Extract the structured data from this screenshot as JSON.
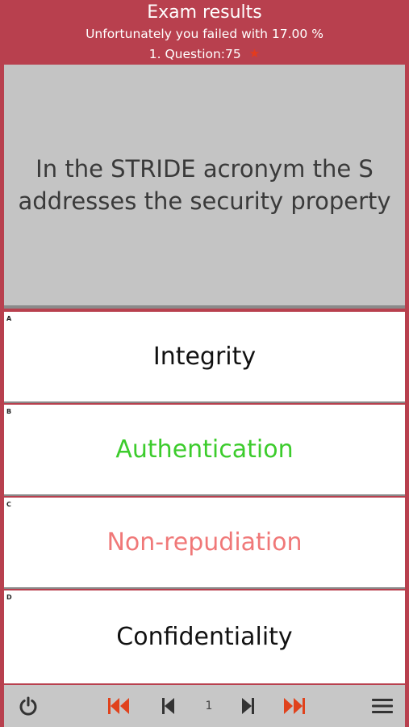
{
  "header": {
    "title": "Exam results",
    "subtitle": "Unfortunately you failed with 17.00 %",
    "question_label": "1. Question:75"
  },
  "question": {
    "text": "In the STRIDE acronym the S addresses the security property"
  },
  "answers": [
    {
      "letter": "A",
      "text": "Integrity",
      "state": "neutral",
      "color": "#111111"
    },
    {
      "letter": "B",
      "text": "Authentication",
      "state": "correct",
      "color": "#3ccc2c"
    },
    {
      "letter": "C",
      "text": "Non-repudiation",
      "state": "wrong",
      "color": "#f07878"
    },
    {
      "letter": "D",
      "text": "Confidentiality",
      "state": "neutral",
      "color": "#111111"
    }
  ],
  "toolbar": {
    "page_number": "1",
    "icons": [
      "power-icon",
      "first-page-icon",
      "previous-icon",
      "next-icon",
      "last-page-icon",
      "menu-icon"
    ]
  },
  "colors": {
    "header_bg": "#b8404e",
    "question_bg": "#c4c4c4",
    "accent_orange": "#e0421c",
    "star": "#e53b1c"
  }
}
